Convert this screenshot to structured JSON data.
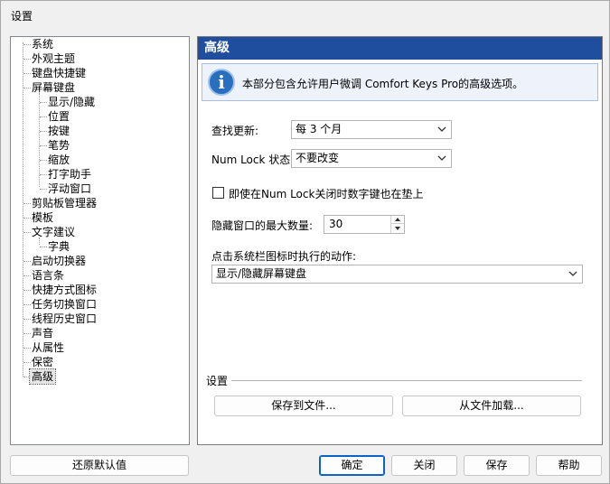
{
  "window": {
    "title": "设置"
  },
  "tree": {
    "items": [
      {
        "label": "系统"
      },
      {
        "label": "外观主题"
      },
      {
        "label": "键盘快捷键"
      },
      {
        "label": "屏幕键盘"
      },
      {
        "label": "显示/隐藏"
      },
      {
        "label": "位置"
      },
      {
        "label": "按键"
      },
      {
        "label": "笔势"
      },
      {
        "label": "缩放"
      },
      {
        "label": "打字助手"
      },
      {
        "label": "浮动窗口"
      },
      {
        "label": "剪贴板管理器"
      },
      {
        "label": "模板"
      },
      {
        "label": "文字建议"
      },
      {
        "label": "字典"
      },
      {
        "label": "启动切换器"
      },
      {
        "label": "语言条"
      },
      {
        "label": "快捷方式图标"
      },
      {
        "label": "任务切换窗口"
      },
      {
        "label": "线程历史窗口"
      },
      {
        "label": "声音"
      },
      {
        "label": "从属性"
      },
      {
        "label": "保密"
      },
      {
        "label": "高级"
      }
    ],
    "selected": "高级"
  },
  "panel": {
    "header": "高级",
    "info_icon": "info-icon",
    "info_text": "本部分包含允许用户微调 Comfort Keys Pro的高级选项。",
    "check_updates_label": "查找更新:",
    "check_updates_value": "每 3 个月",
    "numlock_label": "Num Lock 状态:",
    "numlock_value": "不要改变",
    "numlock_checkbox_label": "即使在Num Lock关闭时数字键也在垫上",
    "numlock_checkbox_checked": false,
    "max_hidden_label": "隐藏窗口的最大数量:",
    "max_hidden_value": "30",
    "tray_action_label": "点击系统栏图标时执行的动作:",
    "tray_action_value": "显示/隐藏屏幕键盘",
    "settings_group_label": "设置",
    "save_to_file": "保存到文件...",
    "load_from_file": "从文件加载..."
  },
  "footer": {
    "restore_defaults": "还原默认值",
    "ok": "确定",
    "close": "关闭",
    "save": "保存",
    "help": "帮助"
  },
  "colors": {
    "header_bg": "#1f4e9e",
    "info_bg": "#eef3fb",
    "accent": "#0a64c8"
  }
}
